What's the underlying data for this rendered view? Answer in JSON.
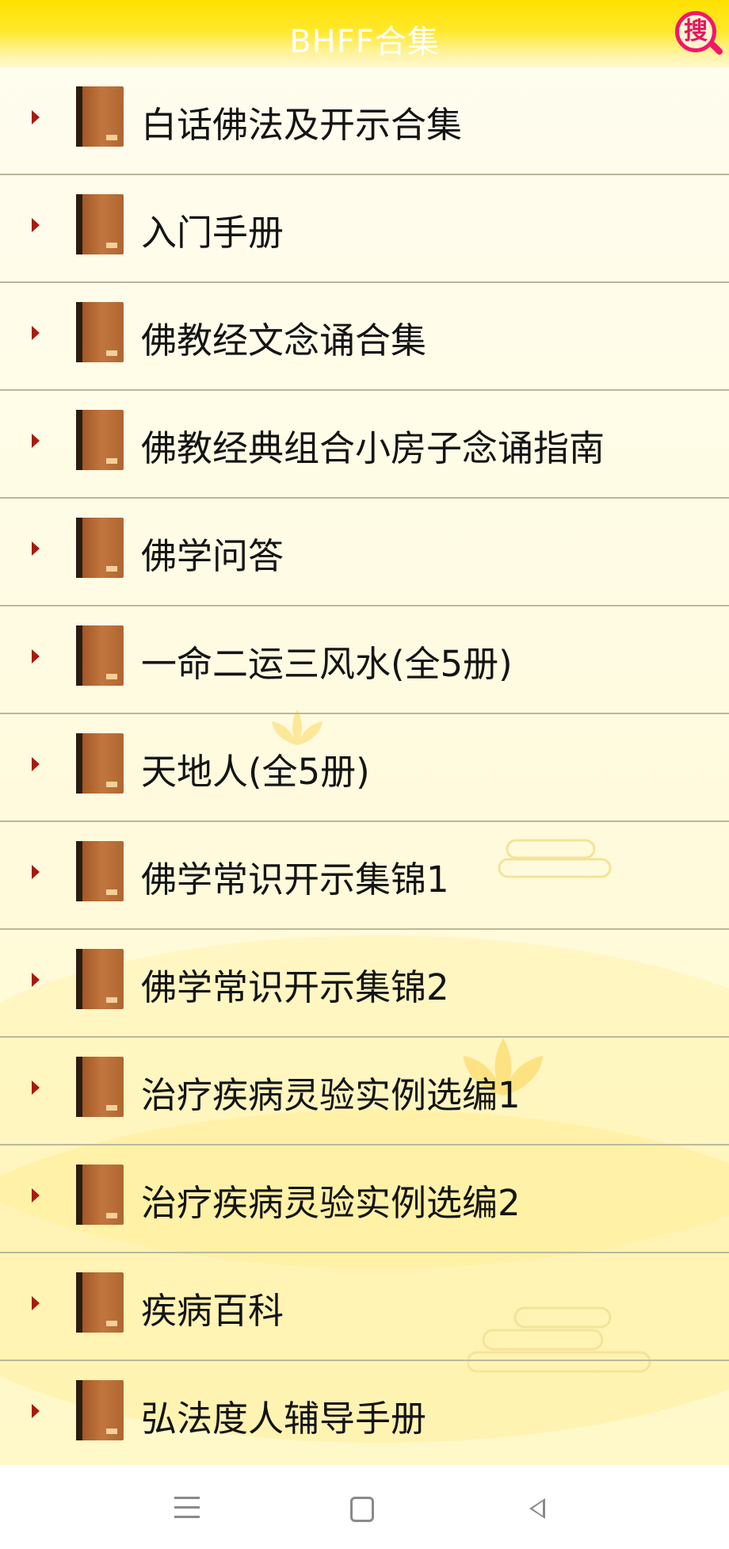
{
  "header": {
    "title": "BHFF合集",
    "search_glyph": "搜",
    "search_icon": "search-magnifier-icon"
  },
  "list": {
    "items": [
      {
        "label": "白话佛法及开示合集"
      },
      {
        "label": "入门手册"
      },
      {
        "label": "佛教经文念诵合集"
      },
      {
        "label": "佛教经典组合小房子念诵指南"
      },
      {
        "label": "佛学问答"
      },
      {
        "label": "一命二运三风水(全5册)"
      },
      {
        "label": "天地人(全5册)"
      },
      {
        "label": "佛学常识开示集锦1"
      },
      {
        "label": "佛学常识开示集锦2"
      },
      {
        "label": "治疗疾病灵验实例选编1"
      },
      {
        "label": "治疗疾病灵验实例选编2"
      },
      {
        "label": "疾病百科"
      },
      {
        "label": "弘法度人辅导手册"
      }
    ]
  },
  "navbar": {
    "icons": [
      "menu-icon",
      "home-square-icon",
      "back-triangle-icon"
    ]
  },
  "colors": {
    "header_yellow": "#ffe100",
    "search_pink": "#f3166b",
    "arrow_red": "#a81b0c",
    "book_brown": "#b06630",
    "divider": "#bdb79a"
  }
}
